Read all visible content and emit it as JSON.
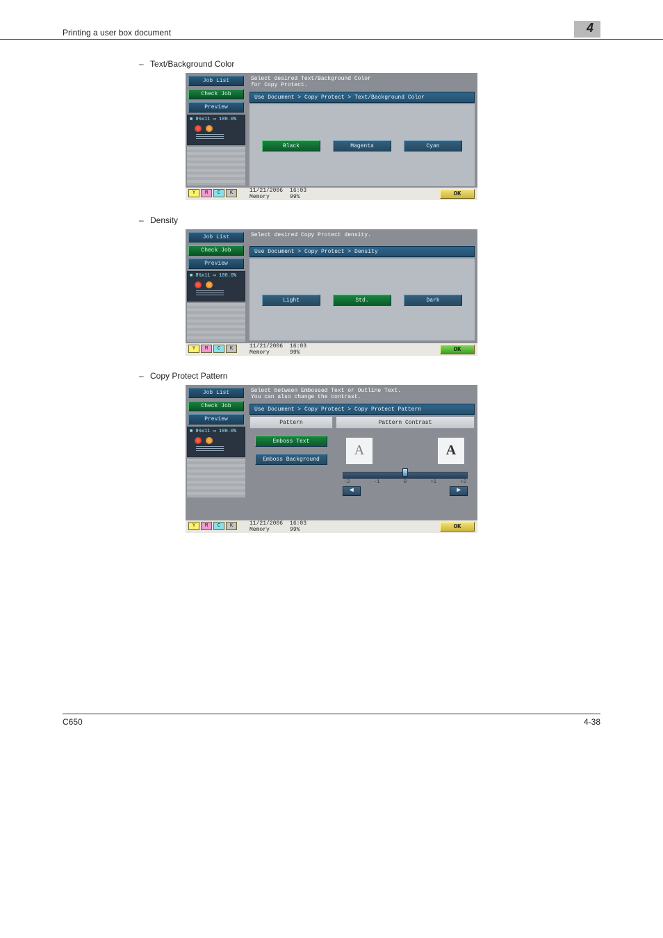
{
  "header": {
    "title": "Printing a user box document",
    "section_no": "4"
  },
  "bullets": {
    "b1": "Text/Background Color",
    "b2": "Density",
    "b3": "Copy Protect Pattern"
  },
  "sidebar": {
    "job_list": "Job List",
    "check_job": "Check Job",
    "preview": "Preview",
    "zoom": "100.0%",
    "paper_code": "8½x11"
  },
  "screen1": {
    "instruction": "Select desired Text/Background Color\nfor Copy Protect.",
    "path": "Use Document > Copy Protect > Text/Background Color",
    "options": [
      "Black",
      "Magenta",
      "Cyan"
    ],
    "selected": 0
  },
  "screen2": {
    "instruction": "Select desired Copy Protect density.",
    "path": "Use Document > Copy Protect > Density",
    "options": [
      "Light",
      "Std.",
      "Dark"
    ],
    "selected": 1
  },
  "screen3": {
    "instruction": "Select between Embossed Text or Outline Text.\nYou can also change the contrast.",
    "path": "Use Document > Copy Protect > Copy Protect Pattern",
    "left_header": "Pattern",
    "right_header": "Pattern Contrast",
    "pattern_buttons": {
      "emboss_text": "Emboss Text",
      "emboss_bg": "Emboss Background"
    },
    "ticks": [
      "-2",
      "-1",
      "0",
      "+1",
      "+2"
    ]
  },
  "footer_bar": {
    "date": "11/21/2006",
    "time": "16:03",
    "memory_label": "Memory",
    "memory_value": "99%",
    "toner_y": "Y",
    "toner_m": "M",
    "toner_c": "C",
    "toner_k": "K",
    "ok": "OK"
  },
  "page_footer": {
    "left": "C650",
    "right": "4-38"
  }
}
